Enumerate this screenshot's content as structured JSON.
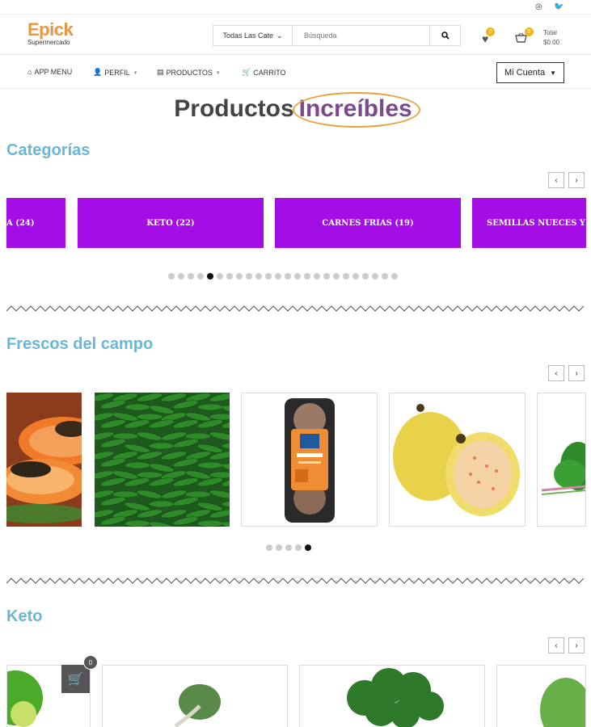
{
  "brand": {
    "name": "Epick",
    "subtitle": "Supermercado"
  },
  "search": {
    "category": "Todas Las Cate",
    "placeholder": "Búsqueda"
  },
  "header": {
    "wishlist_count": "0",
    "cart_count": "0",
    "total_label": "Total",
    "total_value": "$0.00"
  },
  "nav": {
    "items": [
      {
        "label": "APP MENU"
      },
      {
        "label": "PERFIL"
      },
      {
        "label": "PRODUCTOS"
      },
      {
        "label": "CARRITO"
      }
    ],
    "account": "Mi Cuenta"
  },
  "hero": {
    "part1": "Productos",
    "part2": "Increíbles"
  },
  "sections": {
    "categorias": {
      "title": "Categorías",
      "cards": [
        "A (24)",
        "KETO (22)",
        "CARNES FRIAS (19)",
        "SEMILLAS NUECES Y"
      ],
      "dots_total": 24,
      "dots_active": 4
    },
    "frescos": {
      "title": "Frescos del campo",
      "dots_total": 5,
      "dots_active": 4
    },
    "keto": {
      "title": "Keto",
      "cart_count": "0"
    }
  },
  "colors": {
    "accent": "#e8963f",
    "category_bg": "#a30de6",
    "section_title": "#6bb6d6",
    "badge": "#f2b31b"
  }
}
